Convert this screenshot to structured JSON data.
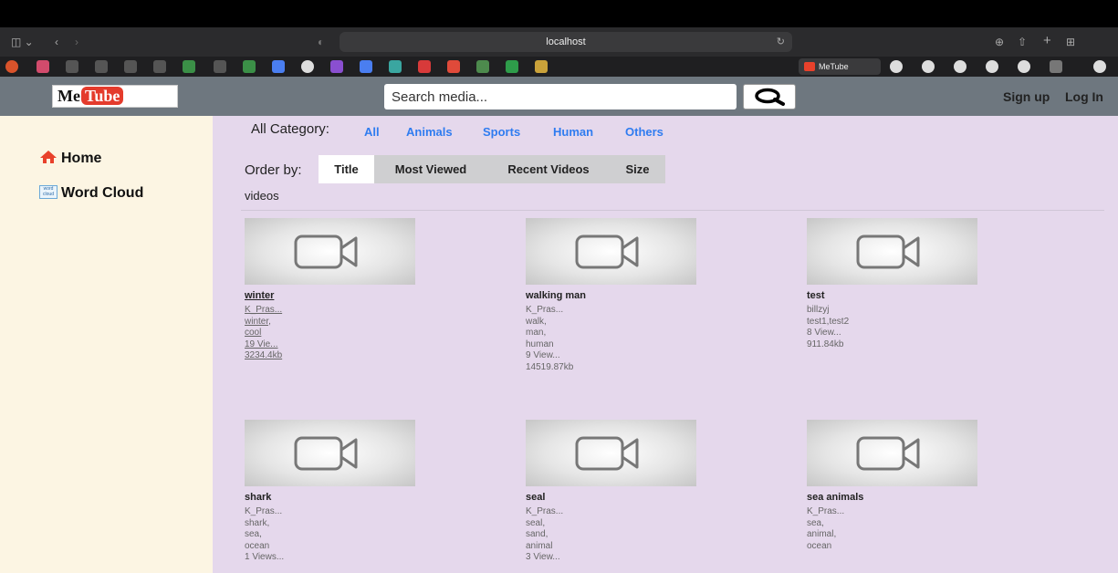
{
  "browser": {
    "url": "localhost",
    "tab_label": "MeTube"
  },
  "header": {
    "logo_me": "Me",
    "logo_tube": "Tube",
    "search_placeholder": "Search media...",
    "signup": "Sign up",
    "login": "Log In"
  },
  "sidebar": {
    "home": "Home",
    "wordcloud": "Word Cloud",
    "wordcloud_icon_text": "word cloud"
  },
  "filters": {
    "category_label": "All Category:",
    "categories": [
      "All",
      "Animals",
      "Sports",
      "Human",
      "Others"
    ],
    "order_label": "Order by:",
    "orders": [
      "Title",
      "Most Viewed",
      "Recent Videos",
      "Size"
    ],
    "active_order": "Title"
  },
  "section_label": "videos",
  "videos": [
    {
      "title": "winter",
      "author": "K_Pras...",
      "tags": [
        "winter,",
        "cool"
      ],
      "views": "19 Vie...",
      "size": "3234.4kb"
    },
    {
      "title": "walking man",
      "author": "K_Pras...",
      "tags": [
        "walk,",
        "man,",
        "human"
      ],
      "views": "9 View...",
      "size": "14519.87kb"
    },
    {
      "title": "test",
      "author": "billzyj",
      "tags": [
        "test1,test2"
      ],
      "views": "8 View...",
      "size": "911.84kb"
    },
    {
      "title": "shark",
      "author": "K_Pras...",
      "tags": [
        "shark,",
        "sea,",
        "ocean"
      ],
      "views": "1 Views...",
      "size": ""
    },
    {
      "title": "seal",
      "author": "K_Pras...",
      "tags": [
        "seal,",
        "sand,",
        "animal"
      ],
      "views": "3 View...",
      "size": ""
    },
    {
      "title": "sea animals",
      "author": "K_Pras...",
      "tags": [
        "sea,",
        "animal,",
        "ocean"
      ],
      "views": "",
      "size": ""
    }
  ],
  "colors": {
    "header_bg": "#6e777f",
    "sidebar_bg": "#fcf5e3",
    "main_bg": "#e5d8ec",
    "category_link": "#2f7cf0",
    "logo_red": "#e43b2c"
  }
}
